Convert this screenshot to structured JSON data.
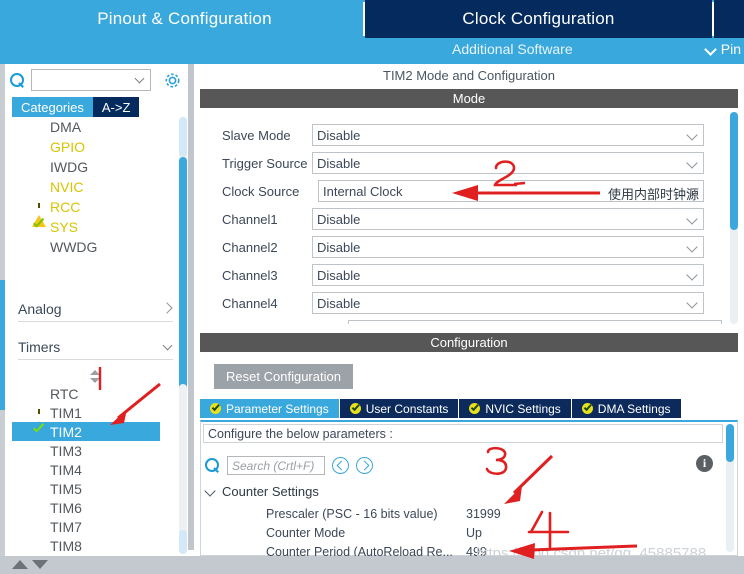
{
  "topbar": {
    "tabs": [
      {
        "label": "Pinout & Configuration",
        "active": false
      },
      {
        "label": "Clock Configuration",
        "active": true
      }
    ],
    "additional_software": "Additional Software",
    "pinout_menu": "Pin",
    "chevron_icon": "chevron-down-icon",
    "accent_light": "#39a8dc",
    "accent_dark": "#042a5e"
  },
  "sidebar": {
    "search": {
      "value": "",
      "placeholder": ""
    },
    "gear_icon": "gear-icon",
    "search_icon": "search-icon",
    "category_tabs": [
      {
        "label": "Categories",
        "active": true
      },
      {
        "label": "A->Z",
        "active": false
      }
    ],
    "peripherals": [
      {
        "label": "DMA",
        "icon": "none",
        "color": "gray"
      },
      {
        "label": "GPIO",
        "icon": "none",
        "color": "yellow"
      },
      {
        "label": "IWDG",
        "icon": "none",
        "color": "gray"
      },
      {
        "label": "NVIC",
        "icon": "none",
        "color": "yellow"
      },
      {
        "label": "RCC",
        "icon": "warning-icon",
        "color": "yellow"
      },
      {
        "label": "SYS",
        "icon": "check-icon",
        "color": "yellow"
      },
      {
        "label": "WWDG",
        "icon": "none",
        "color": "gray"
      }
    ],
    "groups": [
      {
        "label": "Analog",
        "expanded": false,
        "chevron": "chevron-right-icon"
      },
      {
        "label": "Timers",
        "expanded": true,
        "chevron": "chevron-down-icon"
      }
    ],
    "timers": [
      {
        "label": "RTC",
        "icon": "none",
        "selected": false
      },
      {
        "label": "TIM1",
        "icon": "warning-icon",
        "selected": false
      },
      {
        "label": "TIM2",
        "icon": "check-icon",
        "selected": true
      },
      {
        "label": "TIM3",
        "icon": "none",
        "selected": false
      },
      {
        "label": "TIM4",
        "icon": "none",
        "selected": false
      },
      {
        "label": "TIM5",
        "icon": "none",
        "selected": false
      },
      {
        "label": "TIM6",
        "icon": "none",
        "selected": false
      },
      {
        "label": "TIM7",
        "icon": "none",
        "selected": false
      },
      {
        "label": "TIM8",
        "icon": "none",
        "selected": false
      }
    ]
  },
  "main": {
    "panel_title": "TIM2 Mode and Configuration",
    "mode_band": "Mode",
    "config_band": "Configuration",
    "mode_rows": [
      {
        "label": "Slave Mode",
        "value": "Disable"
      },
      {
        "label": "Trigger Source",
        "value": "Disable"
      },
      {
        "label": "Clock Source",
        "value": "Internal Clock"
      },
      {
        "label": "Channel1",
        "value": "Disable"
      },
      {
        "label": "Channel2",
        "value": "Disable"
      },
      {
        "label": "Channel3",
        "value": "Disable"
      },
      {
        "label": "Channel4",
        "value": "Disable"
      }
    ],
    "reset_button": "Reset Configuration",
    "config_tabs": [
      {
        "label": "Parameter Settings",
        "active": true
      },
      {
        "label": "User Constants",
        "active": false
      },
      {
        "label": "NVIC Settings",
        "active": false
      },
      {
        "label": "DMA Settings",
        "active": false
      }
    ],
    "configure_hint": "Configure the below parameters :",
    "param_search": {
      "value": "",
      "placeholder": "Search (Crtl+F)"
    },
    "prev_icon": "chevron-left-circle-icon",
    "next_icon": "chevron-right-circle-icon",
    "info_icon": "info-icon",
    "group_label": "Counter Settings",
    "parameters": [
      {
        "name": "Prescaler (PSC - 16 bits value)",
        "value": "31999"
      },
      {
        "name": "Counter Mode",
        "value": "Up"
      },
      {
        "name": "Counter Period (AutoReload Re...",
        "value": "499"
      }
    ]
  },
  "annotations": {
    "marker_1": "|",
    "marker_2": "2",
    "marker_3": "3",
    "marker_4": "4",
    "chinese_note": "使用内部时钟源",
    "color": "#e02020"
  },
  "watermark": "https://blog.csdn.net/qq_45885788"
}
